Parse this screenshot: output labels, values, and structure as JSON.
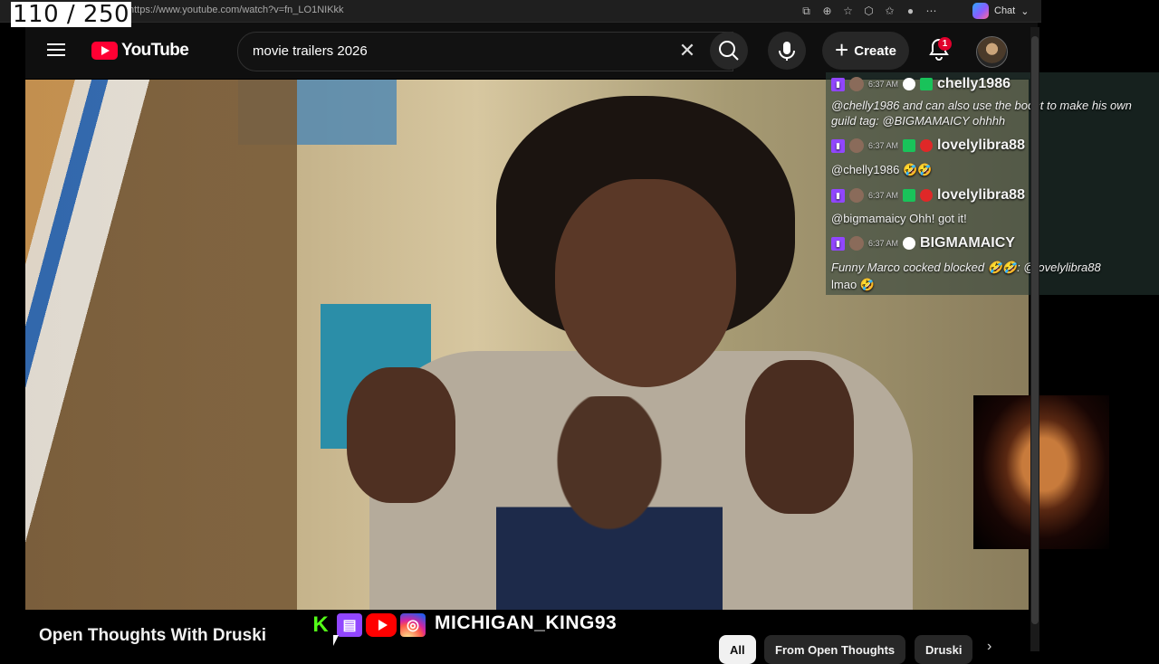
{
  "overlay": {
    "counter": "110 / 250"
  },
  "browser": {
    "url": "https://www.youtube.com/watch?v=fn_LO1NIKkk",
    "chat_label": "Chat"
  },
  "youtube": {
    "logo_text": "YouTube",
    "search_value": "movie trailers 2026",
    "create_label": "Create",
    "notification_count": "1"
  },
  "chat_messages": [
    {
      "time": "6:37 AM",
      "user": "chelly1986"
    },
    {
      "text": "@chelly1986 and can also use the boost to make his own"
    },
    {
      "text": "guild tag: @BIGMAMAICY ohhhh"
    },
    {
      "time": "6:37 AM",
      "user": "lovelylibra88"
    },
    {
      "text": "@chelly1986 🤣🤣"
    },
    {
      "time": "6:37 AM",
      "user": "lovelylibra88"
    },
    {
      "text": "@bigmamaicy Ohh! got it!"
    },
    {
      "time": "6:37 AM",
      "user": "BIGMAMAICY"
    },
    {
      "text": "Funny Marco cocked blocked 🤣🤣: @lovelylibra88"
    },
    {
      "text": "lmao 🤣"
    }
  ],
  "stream": {
    "channel_title": "Open Thoughts With Druski",
    "streamer_name": "MICHIGAN_KING93"
  },
  "chips": [
    "All",
    "From Open Thoughts",
    "Druski"
  ]
}
